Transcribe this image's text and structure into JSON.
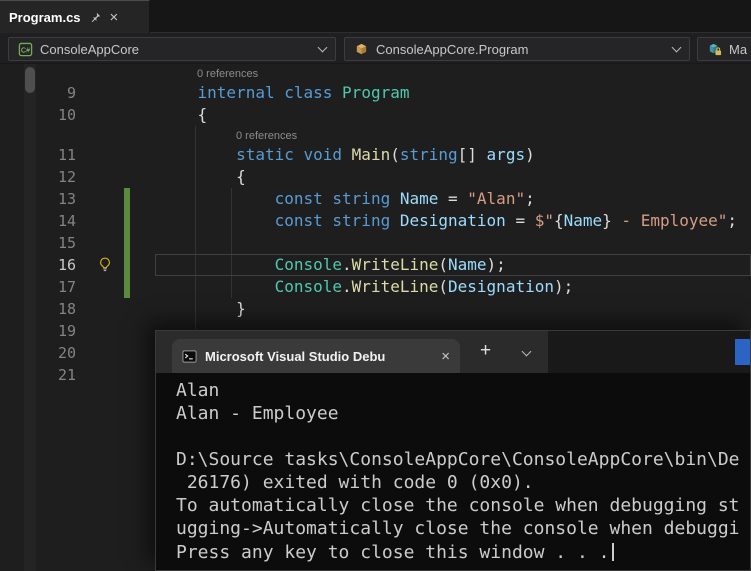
{
  "doc_tab": {
    "title": "Program.cs",
    "close_label": "×"
  },
  "nav": {
    "project": {
      "label": "ConsoleAppCore",
      "icon": "C#"
    },
    "type": {
      "label": "ConsoleAppCore.Program"
    },
    "member": {
      "label": "Ma"
    }
  },
  "editor": {
    "colors": {
      "kw": "#569CD6",
      "cls": "#4EC9B0",
      "mth": "#DCDCAA",
      "str": "#D69D85",
      "var": "#9CDCFE",
      "pl": "#DCDCDC"
    },
    "change_bar_color": "#5b8a3c",
    "rows": [
      {
        "type": "lens",
        "text": "0 references",
        "indent": 38
      },
      {
        "type": "code",
        "num": "9",
        "segments": [
          {
            "t": "    ",
            "c": "pl"
          },
          {
            "t": "internal",
            "c": "kw"
          },
          {
            "t": " ",
            "c": "pl"
          },
          {
            "t": "class",
            "c": "kw"
          },
          {
            "t": " ",
            "c": "pl"
          },
          {
            "t": "Program",
            "c": "cls"
          }
        ]
      },
      {
        "type": "code",
        "num": "10",
        "segments": [
          {
            "t": "    {",
            "c": "pl"
          }
        ]
      },
      {
        "type": "lens",
        "text": "0 references",
        "indent": 77
      },
      {
        "type": "code",
        "num": "11",
        "segments": [
          {
            "t": "        ",
            "c": "pl"
          },
          {
            "t": "static",
            "c": "kw"
          },
          {
            "t": " ",
            "c": "pl"
          },
          {
            "t": "void",
            "c": "kw"
          },
          {
            "t": " ",
            "c": "pl"
          },
          {
            "t": "Main",
            "c": "mth"
          },
          {
            "t": "(",
            "c": "pl"
          },
          {
            "t": "string",
            "c": "kw"
          },
          {
            "t": "[] ",
            "c": "pl"
          },
          {
            "t": "args",
            "c": "var"
          },
          {
            "t": ")",
            "c": "pl"
          }
        ]
      },
      {
        "type": "code",
        "num": "12",
        "segments": [
          {
            "t": "        {",
            "c": "pl"
          }
        ]
      },
      {
        "type": "code",
        "num": "13",
        "changed": true,
        "segments": [
          {
            "t": "            ",
            "c": "pl"
          },
          {
            "t": "const",
            "c": "kw"
          },
          {
            "t": " ",
            "c": "pl"
          },
          {
            "t": "string",
            "c": "kw"
          },
          {
            "t": " ",
            "c": "pl"
          },
          {
            "t": "Name",
            "c": "var"
          },
          {
            "t": " = ",
            "c": "pl"
          },
          {
            "t": "\"Alan\"",
            "c": "str"
          },
          {
            "t": ";",
            "c": "pl"
          }
        ]
      },
      {
        "type": "code",
        "num": "14",
        "changed": true,
        "segments": [
          {
            "t": "            ",
            "c": "pl"
          },
          {
            "t": "const",
            "c": "kw"
          },
          {
            "t": " ",
            "c": "pl"
          },
          {
            "t": "string",
            "c": "kw"
          },
          {
            "t": " ",
            "c": "pl"
          },
          {
            "t": "Designation",
            "c": "var"
          },
          {
            "t": " = ",
            "c": "pl"
          },
          {
            "t": "$\"",
            "c": "str"
          },
          {
            "t": "{",
            "c": "pl"
          },
          {
            "t": "Name",
            "c": "var"
          },
          {
            "t": "}",
            "c": "pl"
          },
          {
            "t": " - Employee\"",
            "c": "str"
          },
          {
            "t": ";",
            "c": "pl"
          }
        ]
      },
      {
        "type": "code",
        "num": "15",
        "changed": true,
        "segments": []
      },
      {
        "type": "code",
        "num": "16",
        "changed": true,
        "current": true,
        "bulb": true,
        "segments": [
          {
            "t": "            ",
            "c": "pl"
          },
          {
            "t": "Console",
            "c": "cls"
          },
          {
            "t": ".",
            "c": "pl"
          },
          {
            "t": "WriteLine",
            "c": "mth"
          },
          {
            "t": "(",
            "c": "pl"
          },
          {
            "t": "Name",
            "c": "var"
          },
          {
            "t": ");",
            "c": "pl"
          }
        ]
      },
      {
        "type": "code",
        "num": "17",
        "changed": true,
        "segments": [
          {
            "t": "            ",
            "c": "pl"
          },
          {
            "t": "Console",
            "c": "cls"
          },
          {
            "t": ".",
            "c": "pl"
          },
          {
            "t": "WriteLine",
            "c": "mth"
          },
          {
            "t": "(",
            "c": "pl"
          },
          {
            "t": "Designation",
            "c": "var"
          },
          {
            "t": ");",
            "c": "pl"
          }
        ]
      },
      {
        "type": "code",
        "num": "18",
        "segments": [
          {
            "t": "        }",
            "c": "pl"
          }
        ]
      },
      {
        "type": "code",
        "num": "19",
        "segments": []
      },
      {
        "type": "code",
        "num": "20",
        "segments": []
      },
      {
        "type": "code",
        "num": "21",
        "segments": []
      }
    ]
  },
  "console": {
    "tab_title": "Microsoft Visual Studio Debu",
    "close_label": "×",
    "new_tab_label": "+",
    "accent_fragment_color": "#2b64c4",
    "cursor_visible": true,
    "lines": [
      "Alan",
      "Alan - Employee",
      "",
      "D:\\Source tasks\\ConsoleAppCore\\ConsoleAppCore\\bin\\De",
      " 26176) exited with code 0 (0x0).",
      "To automatically close the console when debugging st",
      "ugging->Automatically close the console when debuggi",
      "Press any key to close this window . . ."
    ]
  }
}
